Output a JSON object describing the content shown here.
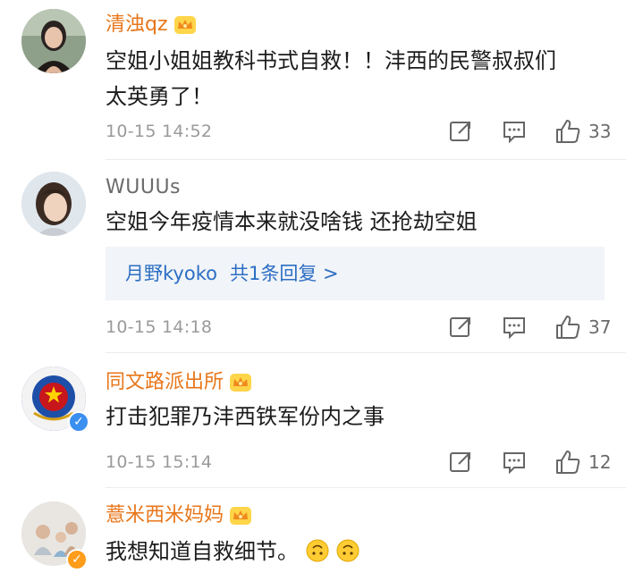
{
  "comments": [
    {
      "username": "清浊qz",
      "text_lines": [
        "空姐小姐姐教科书式自救！！沣西的民警叔叔们",
        "太英勇了！"
      ],
      "time": "10-15 14:52",
      "likes": "33"
    },
    {
      "username": "WUUUs",
      "text_lines": [
        "空姐今年疫情本来就没啥钱 还抢劫空姐"
      ],
      "reply": {
        "author": "月野kyoko",
        "summary": "共1条回复 >"
      },
      "time": "10-15 14:18",
      "likes": "37"
    },
    {
      "username": "同文路派出所",
      "text_lines": [
        "打击犯罪乃沣西铁军份内之事"
      ],
      "time": "10-15 15:14",
      "likes": "12"
    },
    {
      "username": "薏米西米妈妈",
      "text_lines": [
        "我想知道自救细节。"
      ]
    }
  ],
  "colors": {
    "vip_name": "#e8761a",
    "plain_name": "#6b6b6b",
    "reply_link": "#2c6ec3",
    "reply_bg": "#f1f4f8"
  },
  "icons": [
    "share-icon",
    "comment-icon",
    "like-icon",
    "vip-crown-icon",
    "verified-badge-icon",
    "upside-down-face-emoji"
  ]
}
